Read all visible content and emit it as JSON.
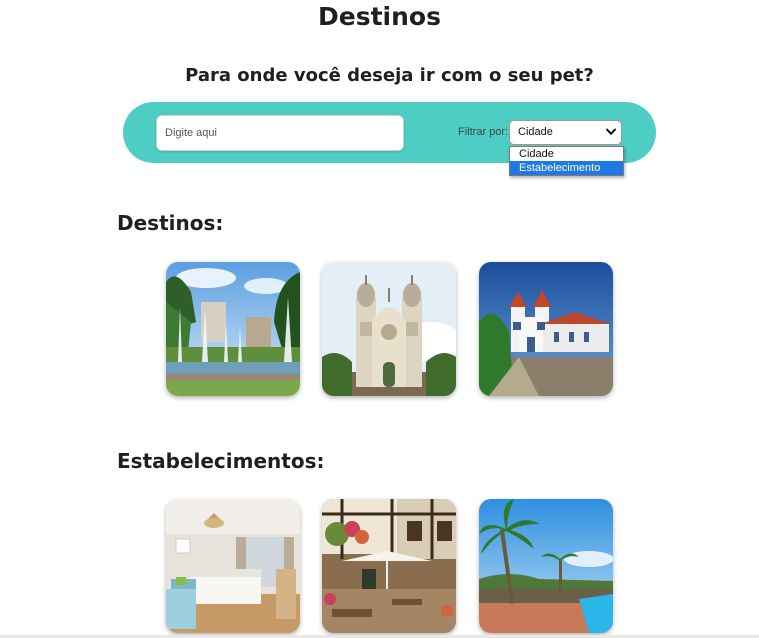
{
  "page": {
    "title": "Destinos",
    "subtitle": "Para onde você deseja ir com o seu pet?"
  },
  "search": {
    "placeholder": "Digite aqui",
    "value": "",
    "filter_label": "Filtrar por:",
    "filter_selected": "Cidade",
    "filter_options": [
      "Cidade",
      "Estabelecimento"
    ],
    "highlighted_option": "Estabelecimento"
  },
  "sections": {
    "destinos": {
      "title": "Destinos:",
      "cards": [
        {
          "image": "fountain-park-photo"
        },
        {
          "image": "baroque-church-photo"
        },
        {
          "image": "colonial-church-photo"
        }
      ]
    },
    "estabelecimentos": {
      "title": "Estabelecimentos:",
      "cards": [
        {
          "image": "hotel-room-photo"
        },
        {
          "image": "colonial-inn-courtyard-photo"
        },
        {
          "image": "resort-pool-palm-photo"
        }
      ]
    }
  },
  "colors": {
    "search_bar": "#4ecdc4",
    "option_highlight": "#1e78e5"
  }
}
